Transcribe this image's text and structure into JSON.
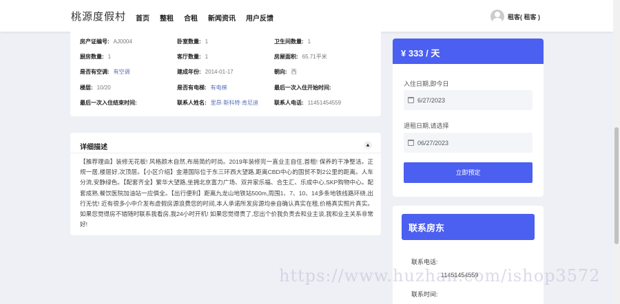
{
  "header": {
    "logo": "桃源度假村",
    "nav": [
      "首页",
      "整租",
      "合租",
      "新闻资讯",
      "用户反馈"
    ],
    "user": "租客( 租客 )"
  },
  "info": {
    "rows": [
      [
        {
          "label": "房产证编号:",
          "value": "AJ0004"
        },
        {
          "label": "卧室数量:",
          "value": "1"
        },
        {
          "label": "卫生间数量:",
          "value": "1"
        }
      ],
      [
        {
          "label": "厨房数量:",
          "value": "1"
        },
        {
          "label": "客厅数量:",
          "value": "1"
        },
        {
          "label": "房屋面积:",
          "value": "65.71平米"
        }
      ],
      [
        {
          "label": "是否有空调:",
          "value": "有空调"
        },
        {
          "label": "建成年份:",
          "value": "2014-01-17"
        },
        {
          "label": "朝向:",
          "value": "西"
        }
      ],
      [
        {
          "label": "楼层:",
          "value": "10/20"
        },
        {
          "label": "是否有电梯:",
          "value": "有电梯"
        },
        {
          "label": "最后一次入住开始时间:",
          "value": ""
        }
      ],
      [
        {
          "label": "最后一次入住结束时间:",
          "value": ""
        },
        {
          "label": "联系人姓名:",
          "value": "里昂·斯科特·肯尼迪"
        },
        {
          "label": "联系人电话:",
          "value": "11451454559"
        }
      ]
    ]
  },
  "description": {
    "title": "详细描述",
    "body": "【推荐理由】装修无花板!  风格颜木自然,布局简约时尚。2019年装修完一直业主自住,首租!  保养的干净整洁。正规一居,楼层好,次顶层。【小区介绍】金港国际位于东三环西大望路,距离CBD中心的国贸不到2公里的距离。人车分流,安静绿色。【配套齐全】繁华大望路,坐拥北京富力广场、双井家乐福、合生汇、乐成中心,SKP购物中心。配套成熟,餐饮医院加油站一应俱全。【出行便利】距离九龙山地铁站500m,周围1、7、10、14多条地铁线路环绕,出行无忧!  近有很多小中介发布虚假房源浪费您的时间,本人承诺所发房源均亲自确认真实在租,价格真实照片真实。如果您觉得房不错随时联系我看房,我24小时开机!  如果您觉得贵了,您出个价我负责去和业主谈,我和业主关系非常好!"
  },
  "booking": {
    "price": "¥ 333 / 天",
    "checkin_label": "入住日期,即今日",
    "checkin_value": "6/27/2023",
    "checkout_label": "退租日期,请选择",
    "checkout_value": "06/27/2023",
    "button": "立即预定"
  },
  "contact": {
    "title": "联系房东",
    "phone_label": "联系电话:",
    "phone_value": "11451454559",
    "time_label": "联系时间:"
  },
  "watermark": "https://www.huzhan.com/ishop3572",
  "colors": {
    "accent": "#4b5ff0",
    "background": "#eef0f5"
  }
}
